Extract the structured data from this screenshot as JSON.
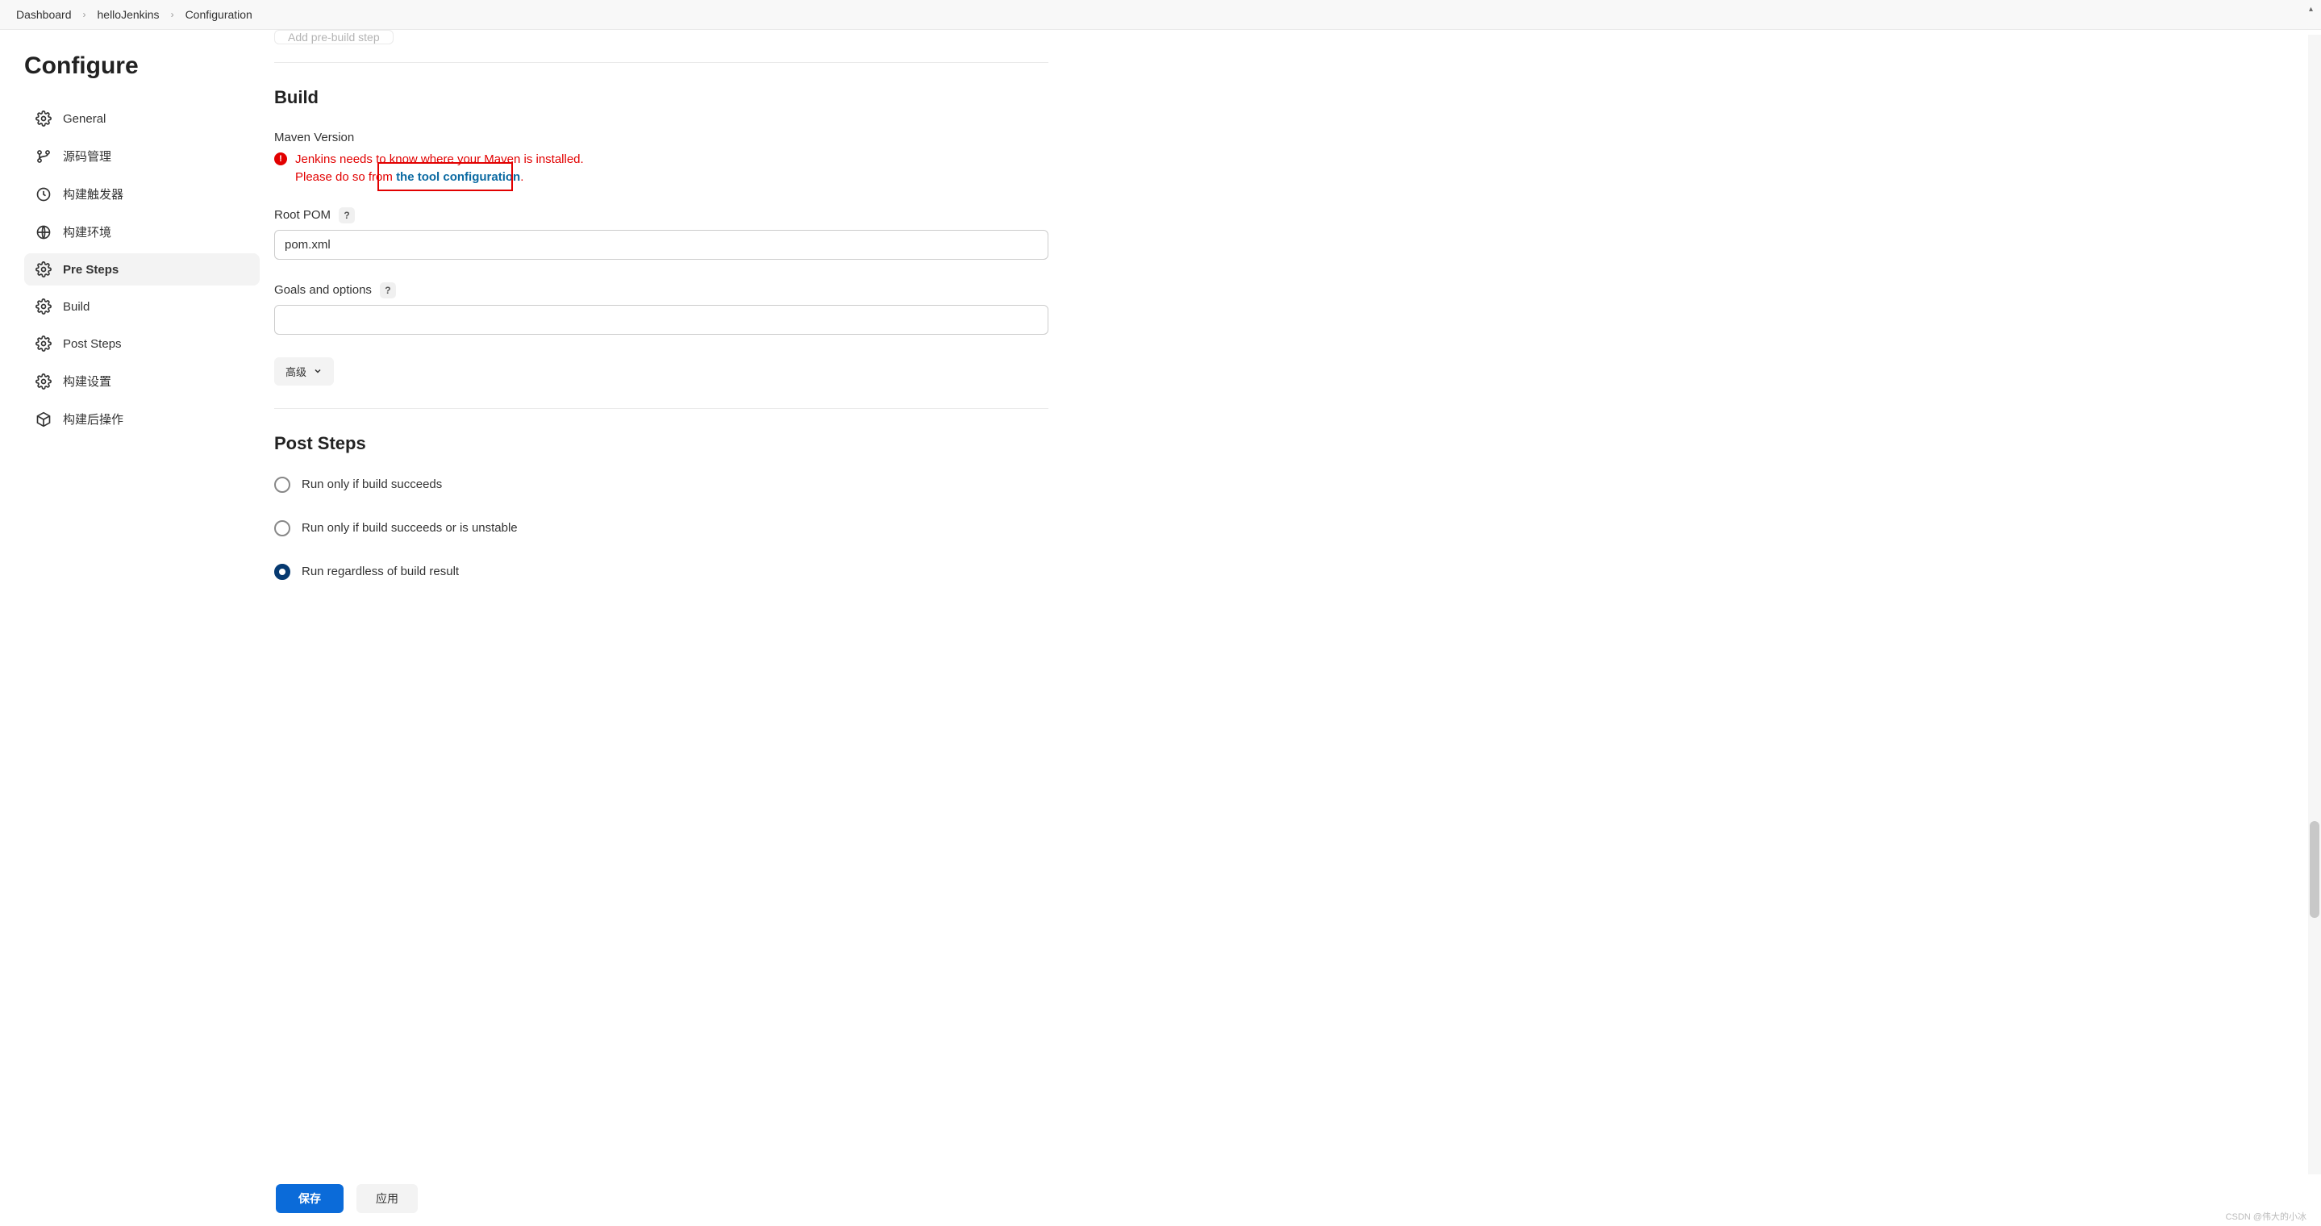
{
  "breadcrumb": {
    "items": [
      "Dashboard",
      "helloJenkins",
      "Configuration"
    ]
  },
  "sidebar": {
    "title": "Configure",
    "items": [
      {
        "label": "General",
        "icon": "gear"
      },
      {
        "label": "源码管理",
        "icon": "branch"
      },
      {
        "label": "构建触发器",
        "icon": "clock"
      },
      {
        "label": "构建环境",
        "icon": "globe"
      },
      {
        "label": "Pre Steps",
        "icon": "gear",
        "active": true
      },
      {
        "label": "Build",
        "icon": "gear"
      },
      {
        "label": "Post Steps",
        "icon": "gear"
      },
      {
        "label": "构建设置",
        "icon": "gear"
      },
      {
        "label": "构建后操作",
        "icon": "package"
      }
    ]
  },
  "prebuild_button": "Add pre-build step",
  "build": {
    "title": "Build",
    "maven_label": "Maven Version",
    "error_line1": "Jenkins needs to know where your Maven is installed.",
    "error_line2_prefix": "Please do so from ",
    "error_link": "the tool configuration",
    "error_suffix": ".",
    "root_pom_label": "Root POM",
    "root_pom_value": "pom.xml",
    "goals_label": "Goals and options",
    "goals_value": "",
    "advanced_label": "高级"
  },
  "post_steps": {
    "title": "Post Steps",
    "options": [
      {
        "label": "Run only if build succeeds",
        "selected": false
      },
      {
        "label": "Run only if build succeeds or is unstable",
        "selected": false
      },
      {
        "label": "Run regardless of build result",
        "selected": true
      }
    ]
  },
  "buttons": {
    "save": "保存",
    "apply": "应用"
  },
  "watermark": "CSDN @伟大的小冰"
}
